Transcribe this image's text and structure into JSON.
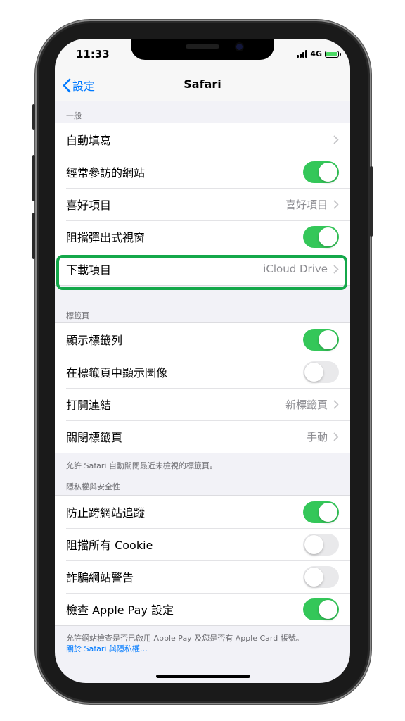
{
  "status": {
    "time": "11:33",
    "network": "4G"
  },
  "nav": {
    "back_label": "設定",
    "title": "Safari"
  },
  "sections": {
    "general": {
      "header": "一般",
      "rows": [
        {
          "label": "自動填寫",
          "value": ""
        },
        {
          "label": "經常參訪的網站",
          "toggle": "on"
        },
        {
          "label": "喜好項目",
          "value": "喜好項目"
        },
        {
          "label": "阻擋彈出式視窗",
          "toggle": "on"
        },
        {
          "label": "下載項目",
          "value": "iCloud Drive"
        }
      ]
    },
    "tabs": {
      "header": "標籤頁",
      "rows": [
        {
          "label": "顯示標籤列",
          "toggle": "on"
        },
        {
          "label": "在標籤頁中顯示圖像",
          "toggle": "off"
        },
        {
          "label": "打開連結",
          "value": "新標籤頁"
        },
        {
          "label": "關閉標籤頁",
          "value": "手動"
        }
      ],
      "footer": "允許 Safari 自動關閉最近未檢視的標籤頁。"
    },
    "privacy": {
      "header": "隱私權與安全性",
      "rows": [
        {
          "label": "防止跨網站追蹤",
          "toggle": "on"
        },
        {
          "label": "阻擋所有 Cookie",
          "toggle": "off"
        },
        {
          "label": "詐騙網站警告",
          "toggle": "off"
        },
        {
          "label": "檢查 Apple Pay 設定",
          "toggle": "on"
        }
      ],
      "footer": "允許網站檢查是否已啟用 Apple Pay 及您是否有 Apple Card 帳號。",
      "footer_link": "關於 Safari 與隱私權…"
    }
  },
  "colors": {
    "accent": "#007aff",
    "toggle_on": "#34c759",
    "highlight": "#14a84a"
  }
}
